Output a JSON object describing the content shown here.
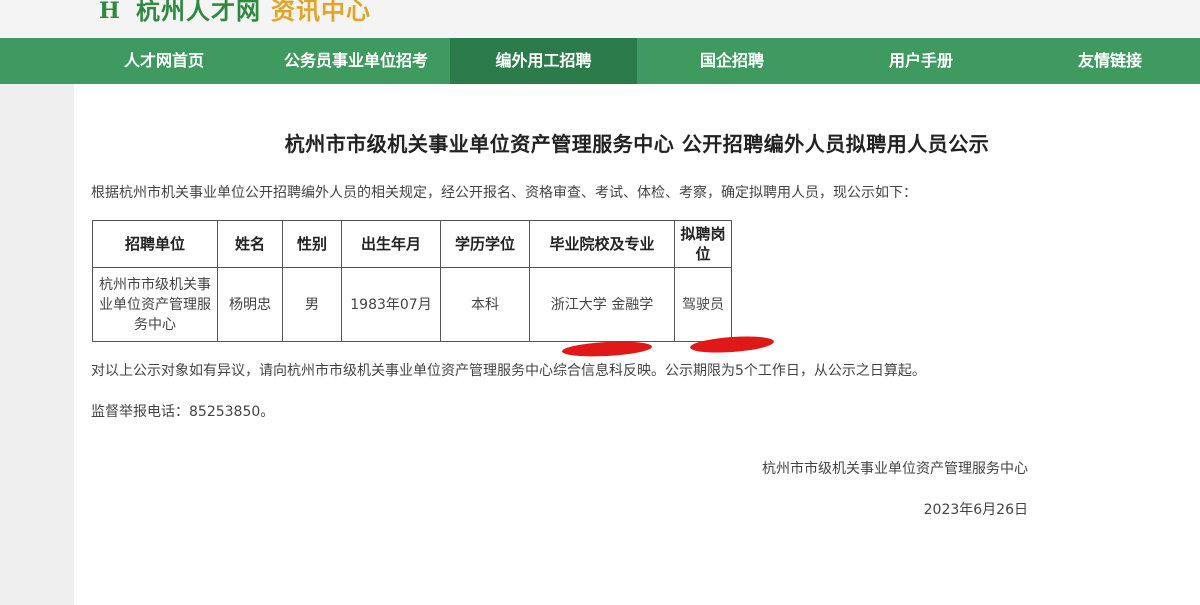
{
  "header": {
    "logo_letter": "H",
    "site_name": "杭州人才网",
    "section_name": "资讯中心"
  },
  "nav": {
    "items": [
      {
        "label": "人才网首页"
      },
      {
        "label": "公务员事业单位招考"
      },
      {
        "label": "编外用工招聘",
        "active": true
      },
      {
        "label": "国企招聘"
      },
      {
        "label": "用户手册"
      },
      {
        "label": "友情链接"
      }
    ]
  },
  "notice": {
    "title": "杭州市市级机关事业单位资产管理服务中心 公开招聘编外人员拟聘用人员公示",
    "intro": "根据杭州市机关事业单位公开招聘编外人员的相关规定，经公开报名、资格审查、考试、体检、考察，确定拟聘用人员，现公示如下：",
    "table": {
      "headers": [
        "招聘单位",
        "姓名",
        "性别",
        "出生年月",
        "学历学位",
        "毕业院校及专业",
        "拟聘岗位"
      ],
      "rows": [
        [
          "杭州市市级机关事业单位资产管理服务中心",
          "杨明忠",
          "男",
          "1983年07月",
          "本科",
          "浙江大学 金融学",
          "驾驶员"
        ]
      ]
    },
    "objection": "对以上公示对象如有异议，请向杭州市市级机关事业单位资产管理服务中心综合信息科反映。公示期限为5个工作日，从公示之日算起。",
    "hotline": "监督举报电话：85253850。",
    "signature": "杭州市市级机关事业单位资产管理服务中心",
    "date": "2023年6月26日"
  },
  "colors": {
    "nav_bg": "#3f9a60",
    "nav_active": "#2c7b4a",
    "brand_green": "#2f8a40",
    "brand_orange": "#e0a52a",
    "annotation_red": "#e01818"
  }
}
